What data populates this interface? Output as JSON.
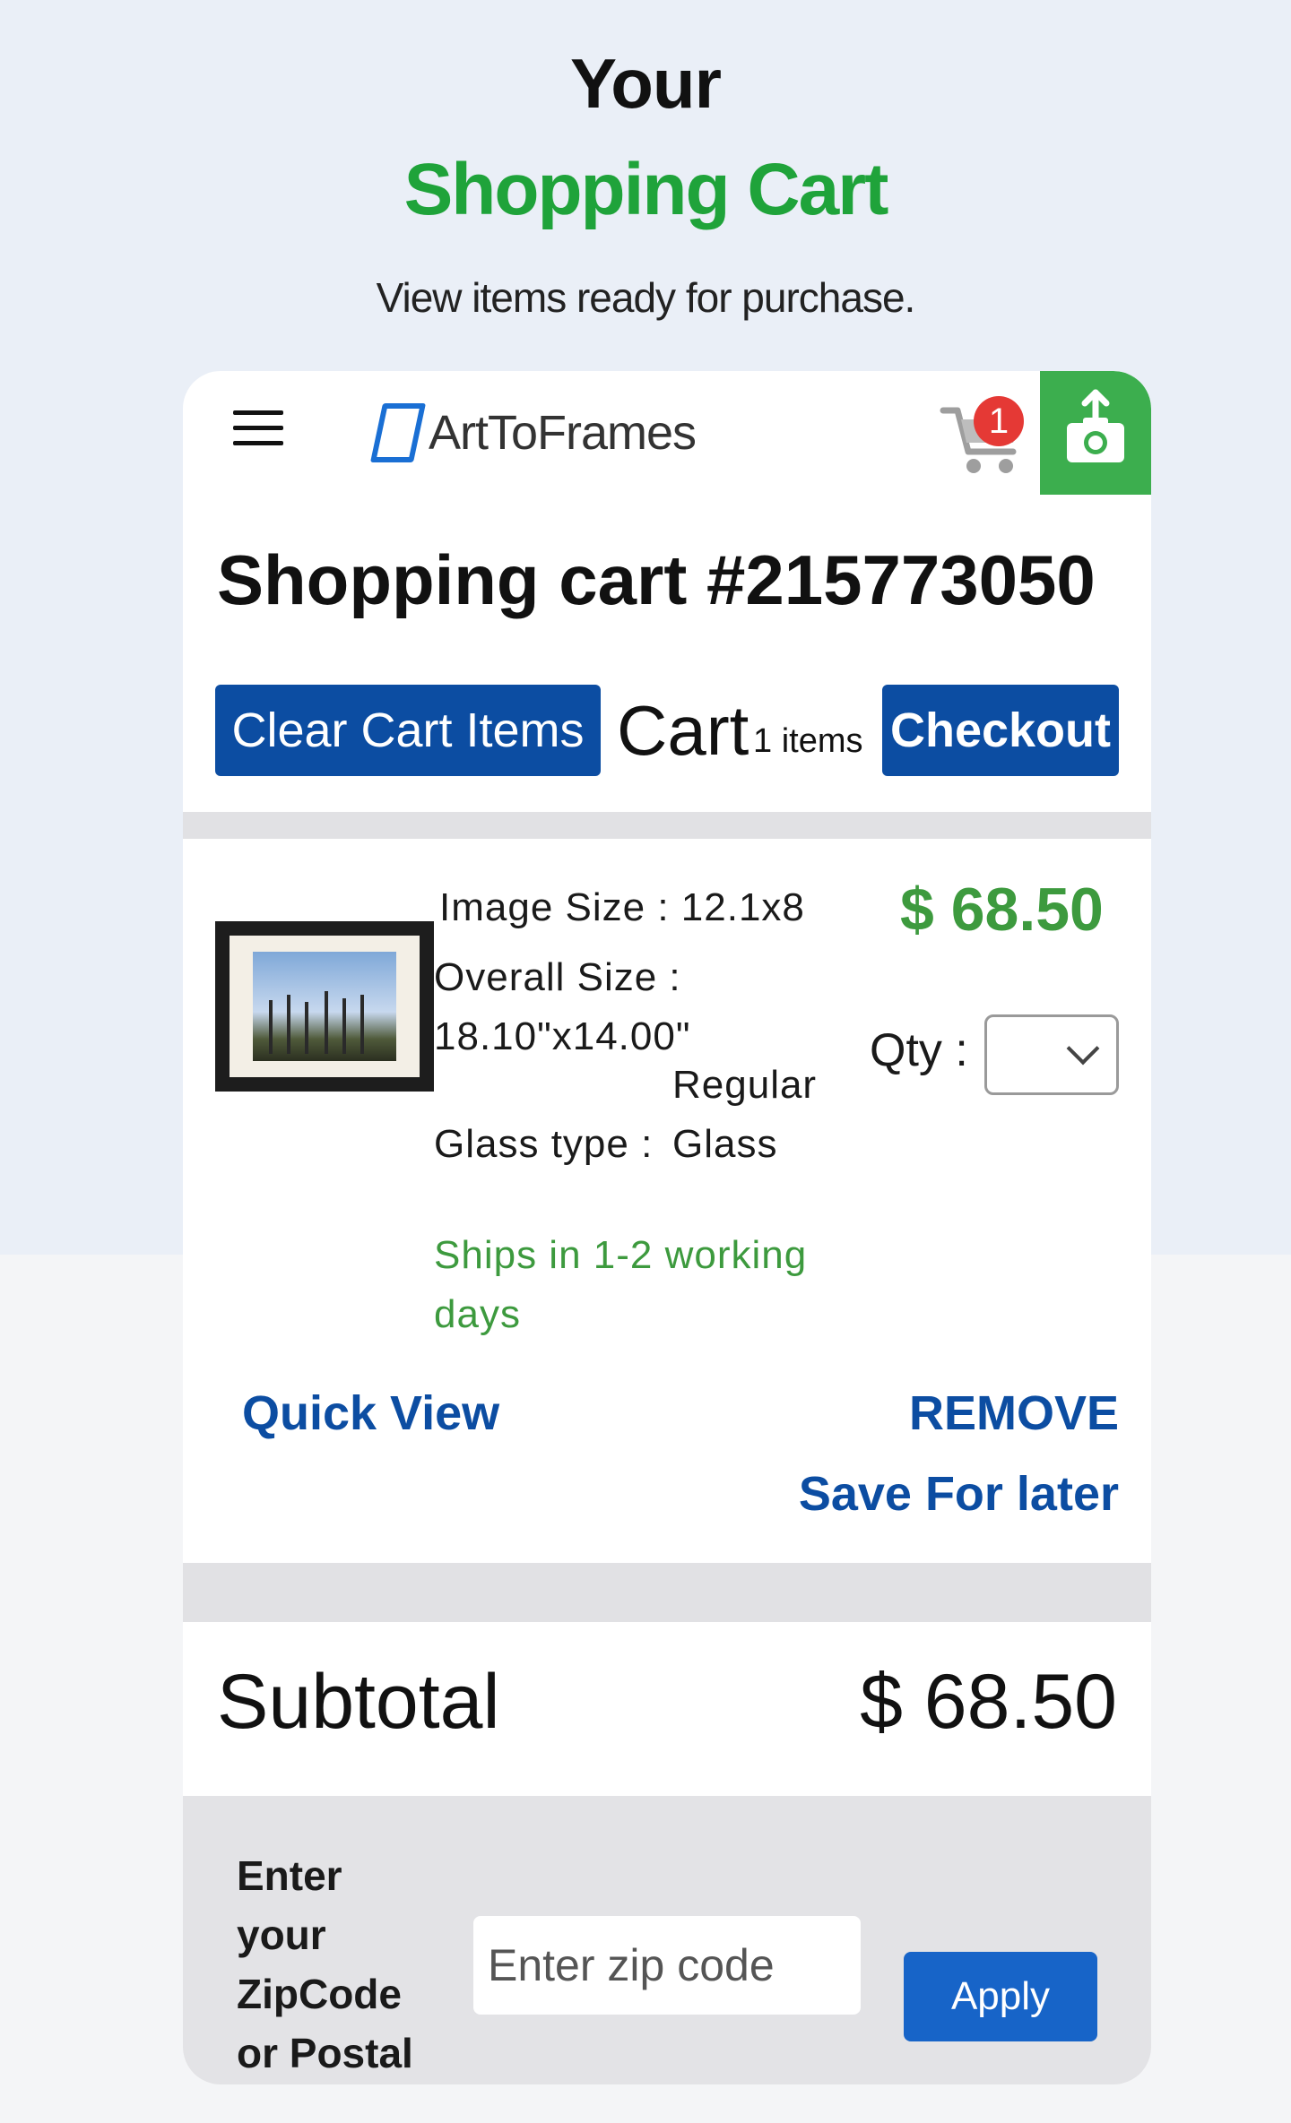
{
  "hero": {
    "title_line1": "Your",
    "title_line2": "Shopping Cart",
    "subtitle": "View items ready for purchase."
  },
  "nav": {
    "logo_text": "ArtToFrames",
    "cart_badge": "1",
    "menu_icon": "hamburger-icon",
    "cart_icon": "shopping-cart-icon",
    "upload_icon": "camera-upload-icon"
  },
  "cart": {
    "title": "Shopping cart #215773050",
    "clear_label": "Clear Cart Items",
    "cart_word": "Cart",
    "item_count": "1 items",
    "checkout_label": "Checkout"
  },
  "item": {
    "image_size": "Image Size : 12.1x8",
    "overall_size_label": "Overall Size :",
    "overall_size_value": "18.10\"x14.00\"",
    "glass_type_label": "Glass type :",
    "glass_type_value_1": "Regular",
    "glass_type_value_2": "Glass",
    "ships": "Ships in 1-2 working days",
    "price": "$ 68.50",
    "qty_label": "Qty :",
    "quick_view": "Quick View",
    "remove": "REMOVE",
    "save_for_later": "Save For later"
  },
  "subtotal": {
    "label": "Subtotal",
    "value": "$ 68.50"
  },
  "zip": {
    "label": "Enter your ZipCode or Postal",
    "placeholder": "Enter zip code",
    "apply_label": "Apply"
  },
  "colors": {
    "brand_green": "#1fa33a",
    "brand_blue": "#0c4da2",
    "price_green": "#3d9a3e",
    "badge_red": "#e53935"
  }
}
